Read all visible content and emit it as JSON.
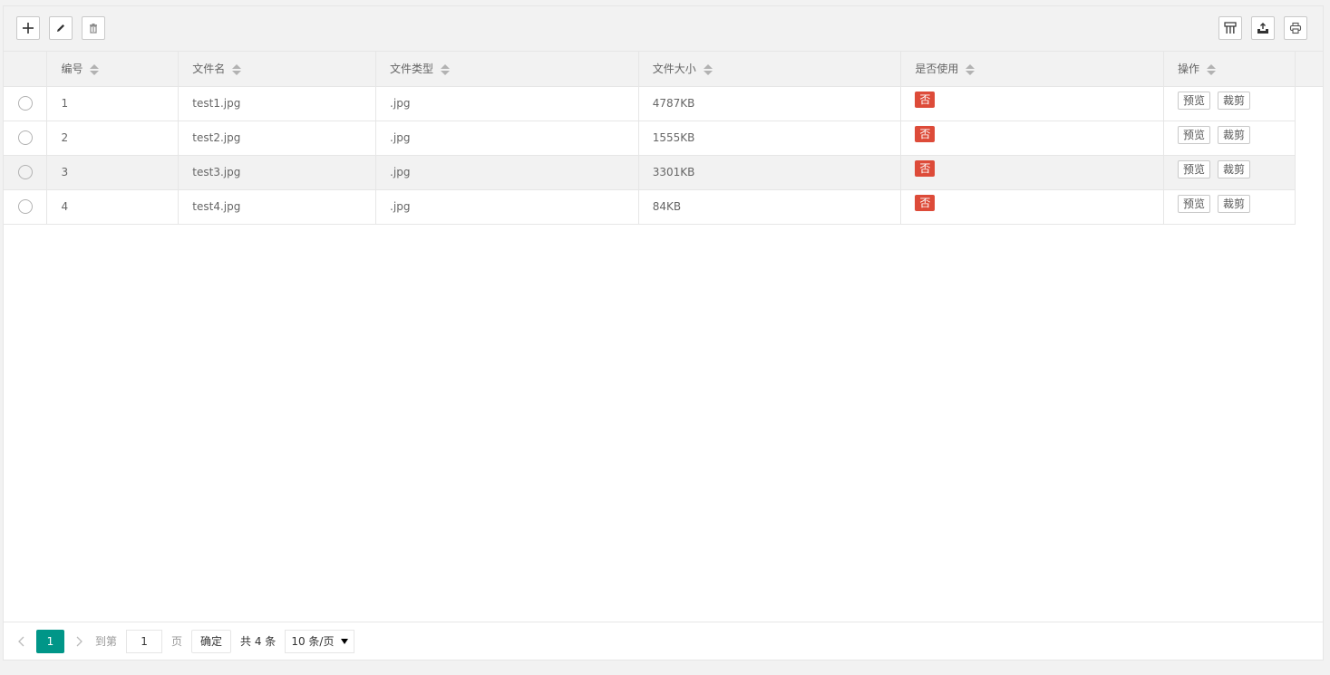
{
  "toolbar": {
    "left_icons": [
      "plus-icon",
      "pencil-icon",
      "trash-icon"
    ],
    "right_icons": [
      "columns-icon",
      "export-icon",
      "print-icon"
    ]
  },
  "table": {
    "headers": [
      "编号",
      "文件名",
      "文件类型",
      "文件大小",
      "是否使用",
      "操作"
    ],
    "rows": [
      {
        "id": "1",
        "name": "test1.jpg",
        "type": ".jpg",
        "size": "4787KB",
        "used": "否"
      },
      {
        "id": "2",
        "name": "test2.jpg",
        "type": ".jpg",
        "size": "1555KB",
        "used": "否"
      },
      {
        "id": "3",
        "name": "test3.jpg",
        "type": ".jpg",
        "size": "3301KB",
        "used": "否"
      },
      {
        "id": "4",
        "name": "test4.jpg",
        "type": ".jpg",
        "size": "84KB",
        "used": "否"
      }
    ],
    "actions": {
      "preview": "预览",
      "crop": "裁剪"
    },
    "hover_row_index": 2
  },
  "pager": {
    "current_page": "1",
    "goto_label": "到第",
    "goto_value": "1",
    "page_label": "页",
    "confirm_label": "确定",
    "total_text": "共 4 条",
    "page_size": "10 条/页"
  },
  "colors": {
    "accent": "#009688",
    "danger_badge": "#dd4b39",
    "header_bg": "#f2f2f2",
    "border": "#e6e6e6"
  }
}
